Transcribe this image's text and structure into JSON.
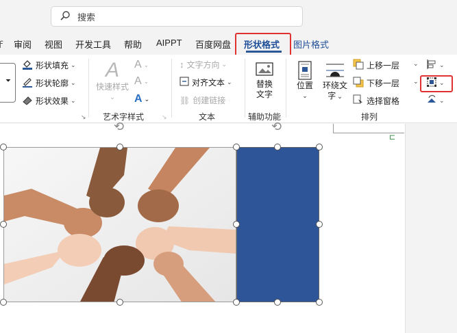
{
  "search": {
    "placeholder": "搜索"
  },
  "tabs": [
    {
      "label": "审阅"
    },
    {
      "label": "视图"
    },
    {
      "label": "开发工具"
    },
    {
      "label": "帮助"
    },
    {
      "label": "AIPPT"
    },
    {
      "label": "百度网盘"
    },
    {
      "label": "形状格式"
    },
    {
      "label": "图片格式"
    }
  ],
  "ribbon": {
    "shape_fill": "形状填充",
    "shape_outline": "形状轮廓",
    "shape_effects": "形状效果",
    "quick_styles": "快速样式",
    "group_wordart": "艺术字样式",
    "text_direction": "文字方向",
    "align_text": "对齐文本",
    "create_link": "创建链接",
    "group_text": "文本",
    "alt_text": "替换\n文字",
    "alt_text_1": "替换",
    "alt_text_2": "文字",
    "group_access": "辅助功能",
    "position": "位置",
    "wrap_text_1": "环绕文",
    "wrap_text_2": "字",
    "bring_forward": "上移一层",
    "send_backward": "下移一层",
    "selection_pane": "选择窗格",
    "group_arrange": "排列"
  },
  "colors": {
    "accent": "#2b5797",
    "highlight": "#e03030",
    "shape_fill": "#2e5597"
  }
}
